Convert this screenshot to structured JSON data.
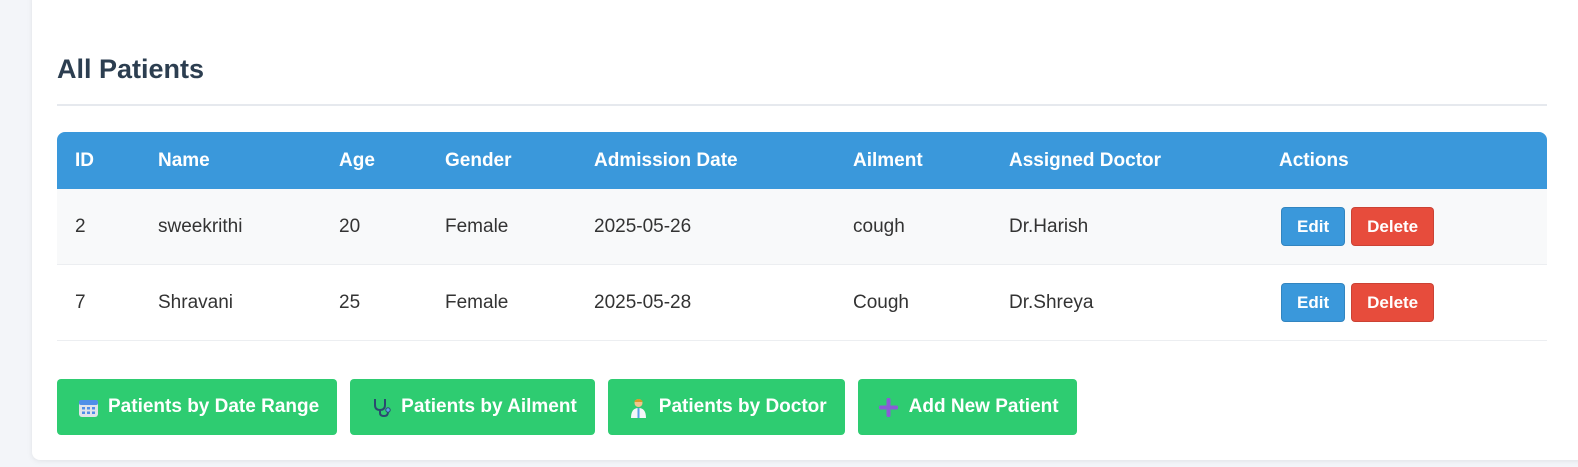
{
  "page": {
    "title": "All Patients"
  },
  "table": {
    "headers": [
      "ID",
      "Name",
      "Age",
      "Gender",
      "Admission Date",
      "Ailment",
      "Assigned Doctor",
      "Actions"
    ],
    "rows": [
      {
        "id": "2",
        "name": "sweekrithi",
        "age": "20",
        "gender": "Female",
        "admission_date": "2025-05-26",
        "ailment": "cough",
        "doctor": "Dr.Harish"
      },
      {
        "id": "7",
        "name": "Shravani",
        "age": "25",
        "gender": "Female",
        "admission_date": "2025-05-28",
        "ailment": "Cough",
        "doctor": "Dr.Shreya"
      }
    ],
    "edit_label": "Edit",
    "delete_label": "Delete"
  },
  "actions": {
    "buttons": [
      {
        "label": "Patients by Date Range",
        "icon": "calendar-icon"
      },
      {
        "label": "Patients by Ailment",
        "icon": "stethoscope-icon"
      },
      {
        "label": "Patients by Doctor",
        "icon": "doctor-icon"
      },
      {
        "label": "Add New Patient",
        "icon": "plus-icon"
      }
    ]
  },
  "colors": {
    "header": "#3a98db",
    "edit": "#3a98db",
    "delete": "#e74c3c",
    "action": "#2ecc71",
    "title": "#2c3e50"
  }
}
